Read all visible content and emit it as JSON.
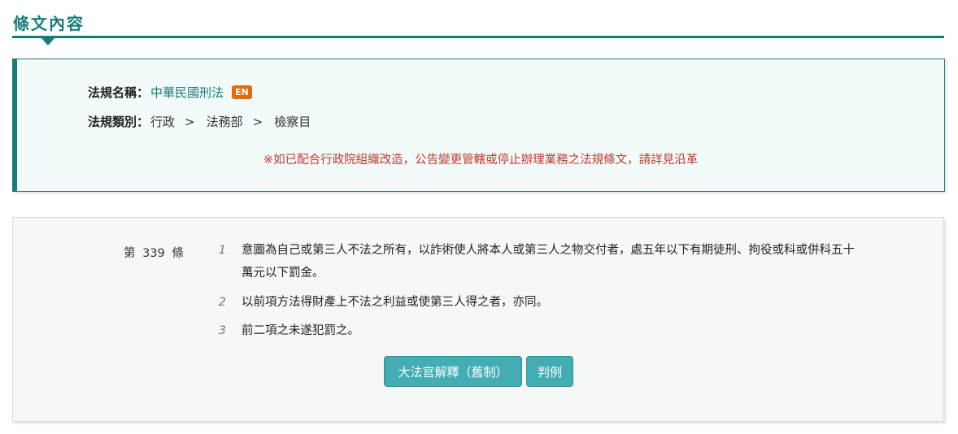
{
  "header": {
    "title": "條文內容"
  },
  "info": {
    "name_label": "法規名稱：",
    "name_value": "中華民國刑法",
    "en_badge": "EN",
    "category_label": "法規類別：",
    "category_path": [
      "行政",
      "法務部",
      "檢察目"
    ],
    "separator": ">",
    "notice": "※如已配合行政院組織改造，公告變更管轄或停止辦理業務之法規條文，請詳見沿革"
  },
  "article": {
    "number": "第 339 條",
    "paragraphs": [
      {
        "num": "1",
        "text": "意圖為自己或第三人不法之所有，以詐術使人將本人或第三人之物交付者，處五年以下有期徒刑、拘役或科或併科五十萬元以下罰金。"
      },
      {
        "num": "2",
        "text": "以前項方法得財產上不法之利益或使第三人得之者，亦同。"
      },
      {
        "num": "3",
        "text": "前二項之未遂犯罰之。"
      }
    ],
    "buttons": {
      "interpretation": "大法官解釋（舊制）",
      "judgment": "判例"
    }
  },
  "colors": {
    "accent": "#177b7a",
    "button": "#43adb3",
    "notice": "#c0392b",
    "badge": "#e56a0b"
  }
}
